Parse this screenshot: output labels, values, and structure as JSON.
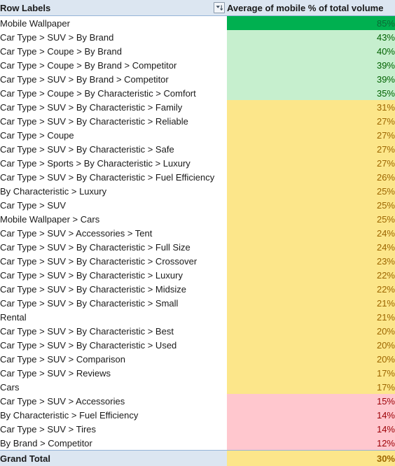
{
  "header": {
    "row_labels": "Row Labels",
    "value_header": "Average of mobile % of total volume",
    "filter_icon": "filter-sort-dropdown-icon"
  },
  "colors": {
    "header_bg": "#DCE6F1",
    "band_dark_green_bg": "#00B050",
    "band_light_green_bg": "#C6EFCE",
    "band_light_green_text": "#006100",
    "band_amber_bg": "#FCE68A",
    "band_amber_text": "#9C6500",
    "band_pink_bg": "#FFC7CE",
    "band_pink_text": "#9C0006"
  },
  "chart_data": {
    "type": "table",
    "title": "Average of mobile % of total volume",
    "columns": [
      "Row Labels",
      "Average of mobile % of total volume"
    ],
    "categories": [
      "Mobile Wallpaper",
      "Car Type > SUV > By Brand",
      "Car Type > Coupe > By Brand",
      "Car Type > Coupe > By Brand > Competitor",
      "Car Type > SUV > By Brand > Competitor",
      "Car Type > Coupe > By Characteristic > Comfort",
      "Car Type > SUV > By Characteristic > Family",
      "Car Type > SUV > By Characteristic > Reliable",
      "Car Type > Coupe",
      "Car Type > SUV > By Characteristic > Safe",
      "Car Type > Sports > By Characteristic > Luxury",
      "Car Type > SUV > By Characteristic > Fuel Efficiency",
      "By Characteristic > Luxury",
      "Car Type > SUV",
      "Mobile Wallpaper > Cars",
      "Car Type > SUV > Accessories > Tent",
      "Car Type > SUV > By Characteristic > Full Size",
      "Car Type > SUV > By Characteristic > Crossover",
      "Car Type > SUV > By Characteristic > Luxury",
      "Car Type > SUV > By Characteristic > Midsize",
      "Car Type > SUV > By Characteristic > Small",
      "Rental",
      "Car Type > SUV > By Characteristic > Best",
      "Car Type > SUV > By Characteristic > Used",
      "Car Type > SUV > Comparison",
      "Car Type > SUV > Reviews",
      "Cars",
      "Car Type > SUV > Accessories",
      "By Characteristic > Fuel Efficiency",
      "Car Type > SUV > Tires",
      "By Brand > Competitor"
    ],
    "values": [
      85,
      43,
      40,
      39,
      39,
      35,
      31,
      27,
      27,
      27,
      27,
      26,
      25,
      25,
      25,
      24,
      24,
      23,
      22,
      22,
      21,
      21,
      20,
      20,
      20,
      17,
      17,
      15,
      14,
      14,
      12
    ],
    "value_labels": [
      "85%",
      "43%",
      "40%",
      "39%",
      "39%",
      "35%",
      "31%",
      "27%",
      "27%",
      "27%",
      "27%",
      "26%",
      "25%",
      "25%",
      "25%",
      "24%",
      "24%",
      "23%",
      "22%",
      "22%",
      "21%",
      "21%",
      "20%",
      "20%",
      "20%",
      "17%",
      "17%",
      "15%",
      "14%",
      "14%",
      "12%"
    ],
    "bands": [
      "dark",
      "green",
      "green",
      "green",
      "green",
      "green",
      "amber",
      "amber",
      "amber",
      "amber",
      "amber",
      "amber",
      "amber",
      "amber",
      "amber",
      "amber",
      "amber",
      "amber",
      "amber",
      "amber",
      "amber",
      "amber",
      "amber",
      "amber",
      "amber",
      "amber",
      "amber",
      "pink",
      "pink",
      "pink",
      "pink"
    ],
    "total_label": "Grand Total",
    "total_value_label": "30%",
    "total_value": 30,
    "total_band": "amber",
    "ylabel": "Average of mobile % of total volume",
    "xlabel": "Row Labels"
  }
}
